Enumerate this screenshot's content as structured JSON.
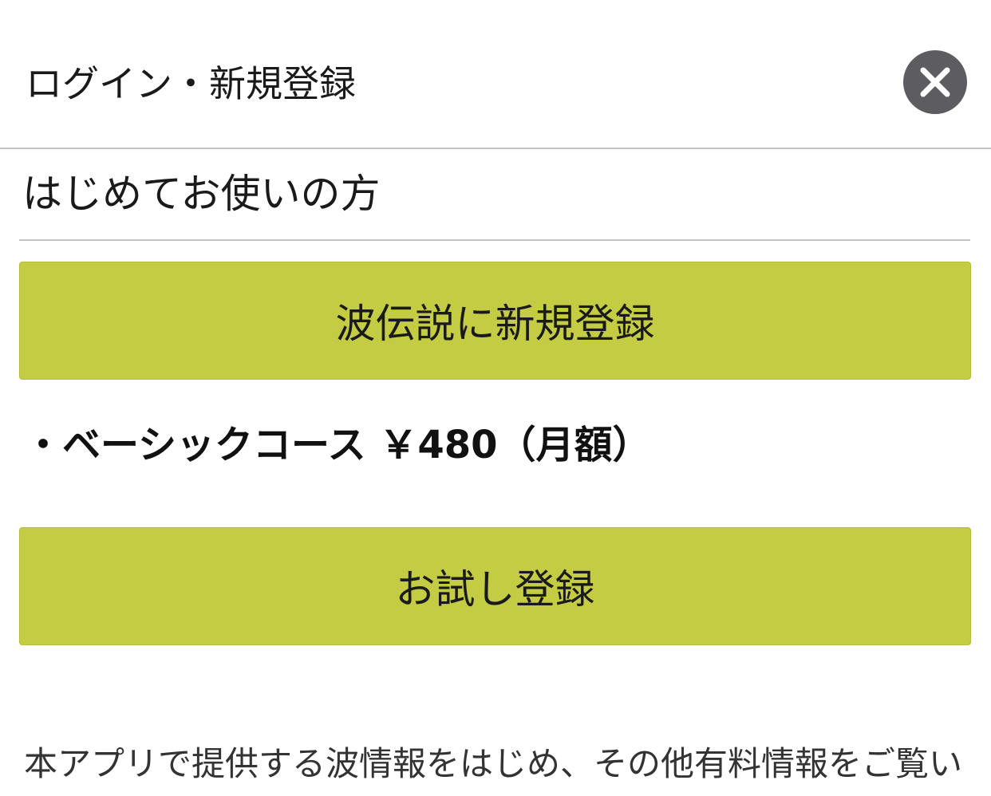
{
  "header": {
    "title": "ログイン・新規登録",
    "close_icon": "close-x-icon"
  },
  "new_user": {
    "section_title": "はじめてお使いの方",
    "register_button_label": "波伝説に新規登録",
    "plan_text": "・ベーシックコース ￥480（月額）",
    "trial_button_label": "お試し登録"
  },
  "notice": {
    "text": "本アプリで提供する波情報をはじめ、その他有料情報をご覧い"
  },
  "colors": {
    "button_green": "#c4cc43",
    "close_button_bg": "#5c5c61",
    "divider": "#c4c4c4"
  }
}
